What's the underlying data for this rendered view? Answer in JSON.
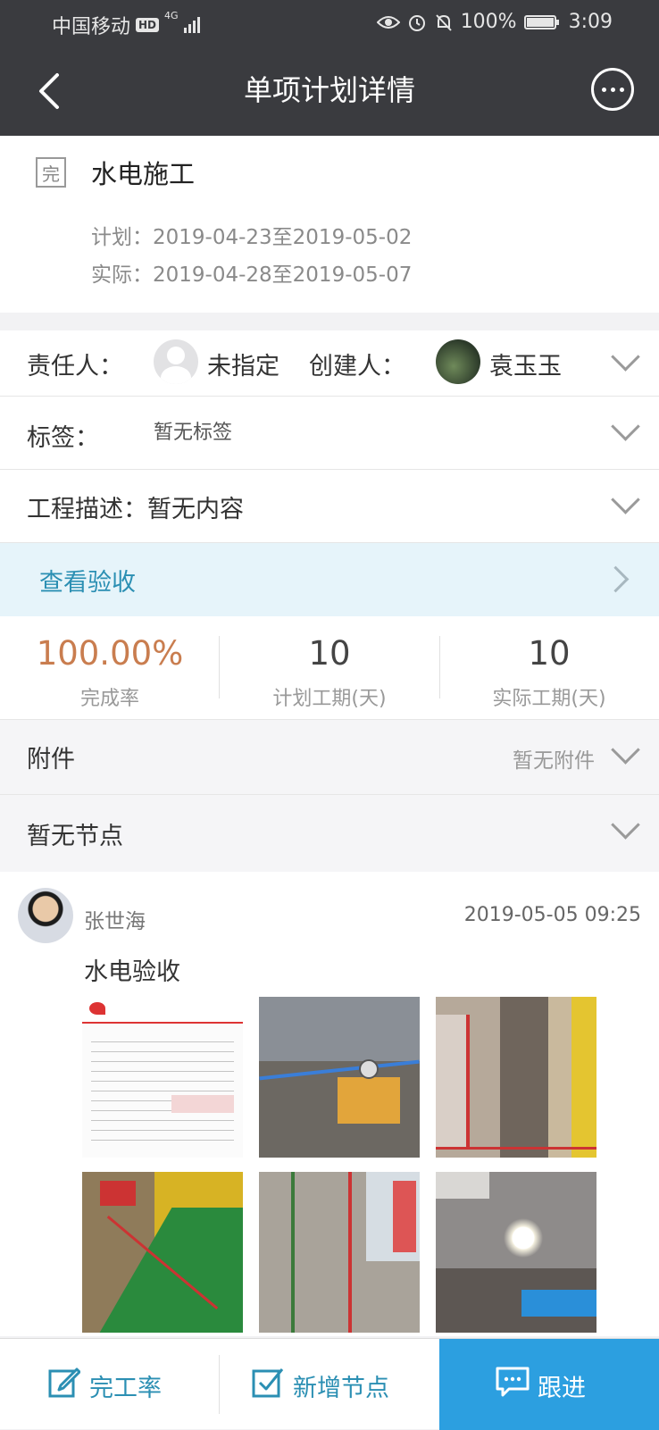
{
  "status_bar": {
    "carrier": "中国移动",
    "hd": "HD",
    "network": "4G",
    "battery": "100%",
    "battery_level": 1.0,
    "time": "3:09"
  },
  "nav": {
    "title": "单项计划详情"
  },
  "task": {
    "status_tag": "完",
    "name": "水电施工",
    "plan_label": "计划：",
    "plan_range": "2019-04-23至2019-05-02",
    "actual_label": "实际：",
    "actual_range": "2019-04-28至2019-05-07"
  },
  "owner_row": {
    "owner_label": "责任人：",
    "owner_name": "未指定",
    "creator_label": "创建人：",
    "creator_name": "袁玉玉"
  },
  "tag_row": {
    "label": "标签：",
    "value": "暂无标签"
  },
  "desc_row": {
    "label": "工程描述：暂无内容"
  },
  "accept_row": {
    "label": "查看验收"
  },
  "stats": [
    {
      "value": "100.00%",
      "caption": "完成率"
    },
    {
      "value": "10",
      "caption": "计划工期(天)"
    },
    {
      "value": "10",
      "caption": "实际工期(天)"
    }
  ],
  "attach_row": {
    "label": "附件",
    "value": "暂无附件"
  },
  "nodes_row": {
    "label": "暂无节点"
  },
  "post": {
    "author": "张世海",
    "time": "2019-05-05 09:25",
    "text": "水电验收",
    "photos": [
      {
        "icon": "photo-inspection-sheet"
      },
      {
        "icon": "photo-pressure-test-pump"
      },
      {
        "icon": "photo-room-red-pipes"
      },
      {
        "icon": "photo-floor-conduits"
      },
      {
        "icon": "photo-wall-pipes"
      },
      {
        "icon": "photo-ceiling-lamp"
      }
    ]
  },
  "bottom_tabs": [
    {
      "label": "完工率",
      "icon": "edit-icon"
    },
    {
      "label": "新增节点",
      "icon": "check-square-icon"
    },
    {
      "label": "跟进",
      "icon": "chat-icon"
    }
  ],
  "colors": {
    "header_bg": "#3a3b3f",
    "accent_blue": "#2b8fb3",
    "primary_tab": "#2c9fe0",
    "rate_accent": "#c97d4f",
    "accept_bg": "#e6f4fa"
  }
}
